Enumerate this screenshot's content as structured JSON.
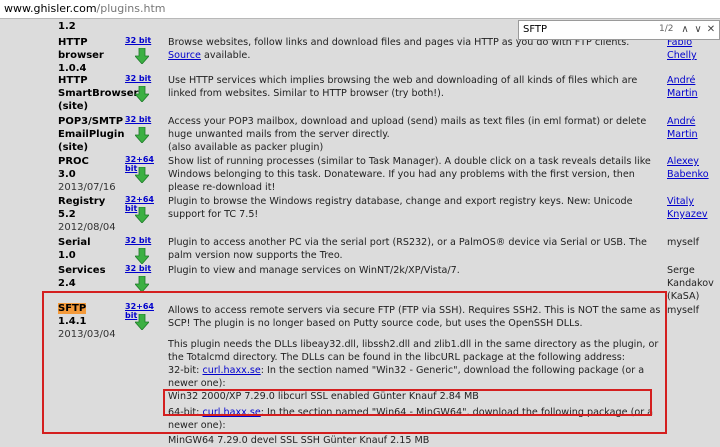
{
  "browser": {
    "url_domain": "www.ghisler.com",
    "url_path": "/plugins.htm"
  },
  "find": {
    "query": "SFTP",
    "count": "1/2"
  },
  "rows": [
    {
      "name": "",
      "version": "1.2",
      "date": "",
      "dl": "",
      "desc": "",
      "author": ""
    },
    {
      "name": "HTTP browser",
      "version": "1.0.4",
      "date": "",
      "dl": "32 bit",
      "desc": "Browse websites, follow links and download files and pages via HTTP as you do with FTP clients.",
      "desc_link": "Source",
      "desc_tail": "available.",
      "author": "Fabio Chelly"
    },
    {
      "name": "HTTP SmartBrowser (site)",
      "version": "",
      "date": "",
      "dl": "32 bit",
      "desc": "Use HTTP services which implies browsing the web and downloading of all kinds of files which are linked from websites. Similar to HTTP browser (try both!).",
      "author": "André Martin"
    },
    {
      "name": "POP3/SMTP EmailPlugin (site)",
      "version": "",
      "date": "",
      "dl": "32 bit",
      "desc": "Access your POP3 mailbox, download and upload (send) mails as text files (in eml format) or delete huge unwanted mails from the server directly.",
      "desc2": "(also available as packer plugin)",
      "author": "André Martin"
    },
    {
      "name": "PROC",
      "version": "3.0",
      "date": "2013/07/16",
      "dl": "32+64 bit",
      "desc": "Show list of running processes (similar to Task Manager). A double click on a task reveals details like Windows belonging to this task. Donateware. If you had any problems with the first version, then please re-download it!",
      "author": "Alexey Babenko"
    },
    {
      "name": "Registry",
      "version": "5.2",
      "date": "2012/08/04",
      "dl": "32+64 bit",
      "desc": "Plugin to browse the Windows registry database, change and export registry keys. New: Unicode support for TC 7.5!",
      "author": "Vitaly Knyazev"
    },
    {
      "name": "Serial",
      "version": "1.0",
      "date": "",
      "dl": "32 bit",
      "desc": "Plugin to access another PC via the serial port (RS232), or a PalmOS® device via Serial or USB. The palm version now supports the Treo.",
      "author": "myself"
    },
    {
      "name": "Services",
      "version": "2.4",
      "date": "",
      "dl": "32 bit",
      "desc": "Plugin to view and manage services on WinNT/2k/XP/Vista/7.",
      "author": "Serge Kandakov (KaSA)"
    },
    {
      "name": "SFTP",
      "version": "1.4.1",
      "date": "2013/03/04",
      "dl": "32+64 bit",
      "p1": "Allows to access remote servers via secure FTP (FTP via SSH). Requires SSH2. This is NOT the same as SCP! The plugin is no longer based on Putty source code, but uses the OpenSSH DLLs.",
      "p2": "This plugin needs the DLLs libeay32.dll, libssh2.dll and zlib1.dll in the same directory as the plugin, or the Totalcmd directory. The DLLs can be found in the libcURL package at the following address:",
      "l32_pre": "32-bit:",
      "l32_link": "curl.haxx.se",
      "l32_post": ": In the section named \"Win32 - Generic\", download the following package (or a newer one):",
      "l32_pkg": "Win32 2000/XP 7.29.0 libcurl SSL enabled Günter Knauf 2.84 MB",
      "l64_pre": "64-bit:",
      "l64_link": "curl.haxx.se",
      "l64_post": ": In the section named \"Win64 - MinGW64\", download the following package (or a newer one):",
      "l64_pkg": "MinGW64 7.29.0 devel SSL SSH Günter Knauf 2.15 MB",
      "author": "myself"
    }
  ],
  "colors": {
    "link": "#0000cc",
    "arrow": "#3cb043",
    "highlight": "#f49a3a",
    "redbox": "#d41f1f"
  }
}
